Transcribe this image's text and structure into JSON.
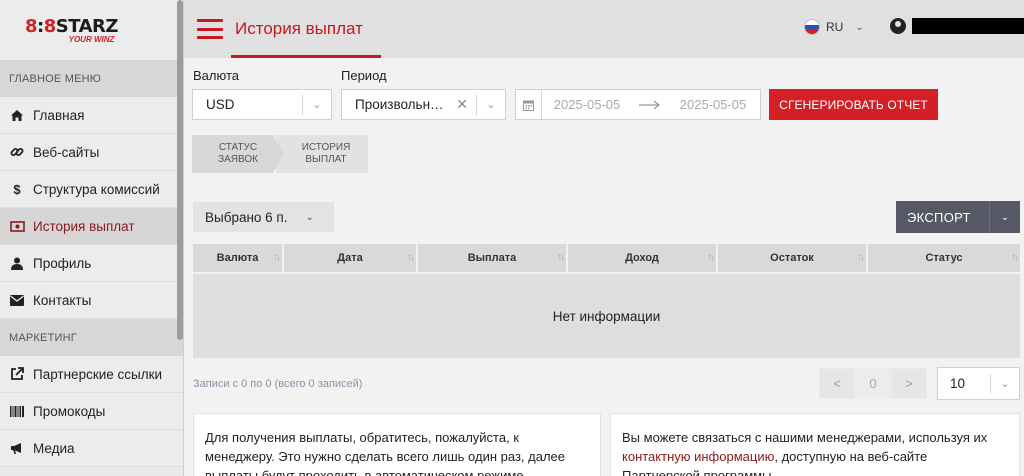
{
  "logo": {
    "brand_left": "8",
    "brand_mid": "8",
    "brand_right": "STARZ",
    "tagline": "YOUR WINZ"
  },
  "sidebar": {
    "main_menu_label": "ГЛАВНОЕ МЕНЮ",
    "marketing_label": "МАРКЕТИНГ",
    "items": [
      {
        "label": "Главная",
        "icon": "home-icon"
      },
      {
        "label": "Веб-сайты",
        "icon": "link-icon"
      },
      {
        "label": "Структура комиссий",
        "icon": "dollar-icon"
      },
      {
        "label": "История выплат",
        "icon": "money-icon",
        "active": true
      },
      {
        "label": "Профиль",
        "icon": "user-icon"
      },
      {
        "label": "Контакты",
        "icon": "envelope-icon"
      }
    ],
    "marketing_items": [
      {
        "label": "Партнерские ссылки",
        "icon": "external-link-icon"
      },
      {
        "label": "Промокоды",
        "icon": "barcode-icon"
      },
      {
        "label": "Медиа",
        "icon": "bullhorn-icon"
      }
    ]
  },
  "header": {
    "title": "История выплат",
    "language": "RU"
  },
  "filters": {
    "currency_label": "Валюта",
    "currency_value": "USD",
    "period_label": "Период",
    "period_value": "Произвольн…",
    "date_from": "2025-05-05",
    "date_to": "2025-05-05",
    "generate_label": "СГЕНЕРИРОВАТЬ ОТЧЕТ"
  },
  "tabs": [
    {
      "label_line1": "СТАТУС",
      "label_line2": "ЗАЯВОК"
    },
    {
      "label_line1": "ИСТОРИЯ",
      "label_line2": "ВЫПЛАТ"
    }
  ],
  "toolbar": {
    "selected_label": "Выбрано 6 п.",
    "export_label": "ЭКСПОРТ"
  },
  "table": {
    "columns": [
      "Валюта",
      "Дата",
      "Выплата",
      "Доход",
      "Остаток",
      "Статус"
    ],
    "empty_text": "Нет информации"
  },
  "pagination": {
    "records_text": "Записи с 0 по 0 (всего 0 записей)",
    "prev": "<",
    "current": "0",
    "next": ">",
    "per_page": "10"
  },
  "info": {
    "left_text": "Для получения выплаты, обратитесь, пожалуйста, к менеджеру. Это нужно сделать всего лишь один раз, далее выплаты будут проходить в автоматическом режиме.",
    "right_text_before": "Вы можете связаться с нашими менеджерами, используя их",
    "right_link": "контактную информацию",
    "right_text_after": ", доступную на веб-сайте Партнерской программы."
  },
  "colors": {
    "accent": "#d32027",
    "active_text": "#8a1a1a",
    "export_bg": "#565865"
  }
}
